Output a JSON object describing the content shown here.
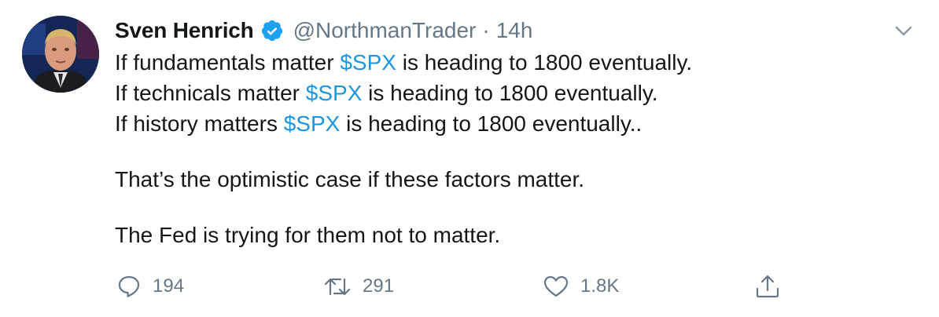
{
  "tweet": {
    "author": {
      "name": "Sven Henrich",
      "handle": "@NorthmanTrader",
      "verified": true,
      "avatar_icon": "avatar-photo"
    },
    "separator": "·",
    "time": "14h",
    "menu_icon": "chevron-down-icon",
    "lines": [
      {
        "pre": "If fundamentals matter ",
        "tag": "$SPX",
        "post": " is heading to 1800 eventually."
      },
      {
        "pre": "If technicals matter ",
        "tag": "$SPX",
        "post": " is heading to 1800 eventually."
      },
      {
        "pre": "If history matters ",
        "tag": "$SPX",
        "post": " is heading to 1800 eventually.."
      }
    ],
    "paragraph2": "That’s the optimistic case if these factors matter.",
    "paragraph3": "The Fed is trying for them not to matter.",
    "actions": {
      "replies": "194",
      "retweets": "291",
      "likes": "1.8K"
    },
    "colors": {
      "link": "#1b95e0",
      "muted": "#657786",
      "text": "#14171a",
      "verified": "#1da1f2"
    }
  }
}
